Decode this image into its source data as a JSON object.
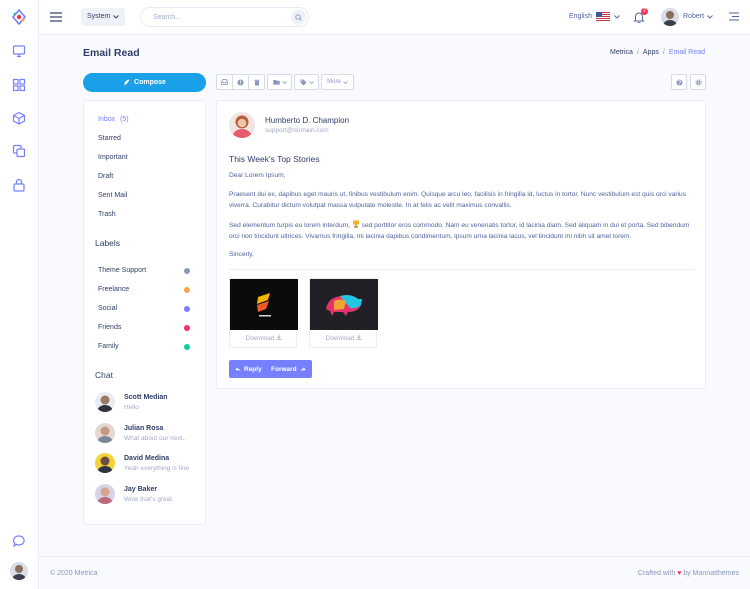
{
  "colors": {
    "accent": "#7680ff",
    "compose": "#1aa0e8",
    "text": "#303e67",
    "muted": "#a4abc5",
    "danger": "#f5325c"
  },
  "topbar": {
    "system_label": "System",
    "search_placeholder": "Search...",
    "language": "English",
    "notification_count": "2",
    "user_name": "Robert"
  },
  "page": {
    "title": "Email Read",
    "breadcrumb": [
      "Metrica",
      "Apps",
      "Email Read"
    ],
    "breadcrumb_sep": "/"
  },
  "sidebar": {
    "compose_label": "Compose",
    "folders": [
      {
        "label": "Inbox",
        "count": "(5)"
      },
      {
        "label": "Starred"
      },
      {
        "label": "Important"
      },
      {
        "label": "Draft"
      },
      {
        "label": "Sent Mail"
      },
      {
        "label": "Trash"
      }
    ],
    "labels_heading": "Labels",
    "labels": [
      {
        "label": "Theme Support",
        "color": "#8997bd"
      },
      {
        "label": "Freelance",
        "color": "#ffa04d"
      },
      {
        "label": "Social",
        "color": "#7680ff"
      },
      {
        "label": "Friends",
        "color": "#f5325c"
      },
      {
        "label": "Family",
        "color": "#12c9a0"
      }
    ],
    "chat_heading": "Chat",
    "chats": [
      {
        "name": "Scott Median",
        "message": "Hello"
      },
      {
        "name": "Julian Rosa",
        "message": "What about our next.."
      },
      {
        "name": "David Medina",
        "message": "Yeah everything is fine"
      },
      {
        "name": "Jay Baker",
        "message": "Wow that's great"
      }
    ]
  },
  "toolbar": {
    "more_label": "More"
  },
  "mail": {
    "sender_name": "Humberto D. Champion",
    "sender_email": "support@domain.com",
    "subject": "This Week's Top Stories",
    "greeting": "Dear Lorem Ipsum,",
    "para1": "Praesent dui ex, dapibus eget mauris ut, finibus vestibulum enim. Quisque arcu leo, facilisis in fringilla id, luctus in tortor. Nunc vestibulum est quis orci varius viverra. Curabitur dictum volutpat massa vulputate molestie. In at felis ac velit maximus convallis.",
    "para2a": "Sed elementum turpis eu lorem interdum,",
    "para2b": "sed porttitor eros commodo. Nam eu venenatis tortor, id lacinia diam. Sed aliquam in dui et porta. Sed bibendum orci non tincidunt ultrices. Vivamus fringilla, mi lacinia dapibus condimentum, ipsum urna lacinia lacus, vel tincidunt mi nibh sit amet lorem.",
    "signoff": "Sincerly,",
    "attachments": [
      {
        "download_label": "Download"
      },
      {
        "download_label": "Download"
      }
    ],
    "reply_label": "Reply",
    "forward_label": "Forward"
  },
  "footer": {
    "copyright": "© 2020 Metrica",
    "crafted_prefix": "Crafted with",
    "crafted_suffix": "by Mannatthemes"
  }
}
